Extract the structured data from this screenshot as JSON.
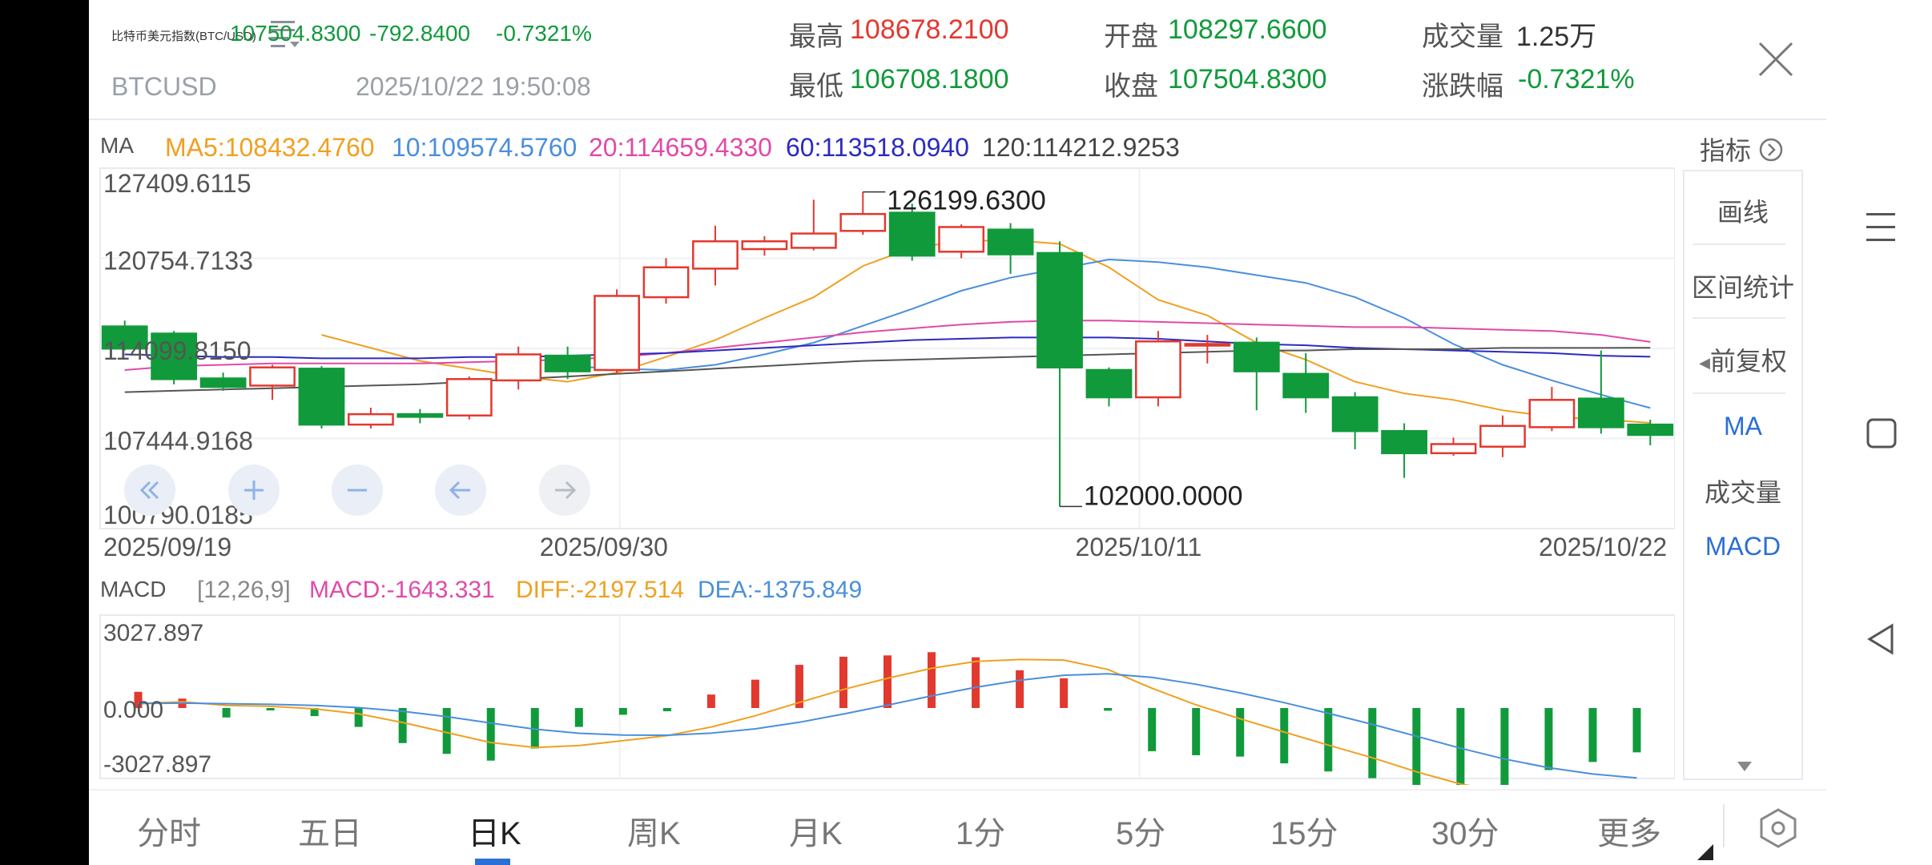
{
  "header": {
    "title": "比特币美元指数(BTC/USD)",
    "symbol": "BTCUSD",
    "price": "107504.8300",
    "change": "-792.8400",
    "change_pct": "-0.7321%",
    "datetime": "2025/10/22 19:50:08",
    "stats": {
      "high_label": "最高",
      "high": "108678.2100",
      "low_label": "最低",
      "low": "106708.1800",
      "open_label": "开盘",
      "open": "108297.6600",
      "close_label": "收盘",
      "close": "107504.8300",
      "volume_label": "成交量",
      "volume": "1.25万",
      "pct_label": "涨跌幅",
      "pct": "-0.7321%"
    }
  },
  "ma_bar": {
    "label": "MA",
    "ma5": "MA5:108432.4760",
    "ma10": "10:109574.5760",
    "ma20": "20:114659.4330",
    "ma60": "60:113518.0940",
    "ma120": "120:114212.9253",
    "indicator_label": "指标"
  },
  "sidebar": {
    "items": [
      "画线",
      "区间统计",
      "前复权",
      "MA",
      "成交量",
      "MACD"
    ]
  },
  "colors": {
    "up": "#e2392f",
    "down": "#119a3b",
    "ma5": "#f0a020",
    "ma10": "#4a8fdc",
    "ma20": "#e04aa8",
    "ma60": "#2b2bc0",
    "ma120": "#555555",
    "accent": "#2a6fd6"
  },
  "icons": {
    "menu": "list-menu-icon",
    "close": "close-icon",
    "indicator": "chevron-right-circle-icon",
    "settings": "hexagon-settings-icon"
  },
  "chart_data": [
    {
      "type": "candlestick",
      "title": "",
      "y_ticks": [
        "127409.6115",
        "120754.7133",
        "114099.8150",
        "107444.9168",
        "100790.0185"
      ],
      "ylim": [
        100790.0185,
        127409.6115
      ],
      "x_ticks": [
        "2025/09/19",
        "2025/09/30",
        "2025/10/11",
        "2025/10/22"
      ],
      "max_label": "126199.6300",
      "min_label": "102000.0000",
      "candles": [
        {
          "o": 115850,
          "h": 116300,
          "l": 114000,
          "c": 114150
        },
        {
          "o": 115300,
          "h": 115500,
          "l": 111400,
          "c": 111800
        },
        {
          "o": 111850,
          "h": 112300,
          "l": 110900,
          "c": 111200
        },
        {
          "o": 111300,
          "h": 112900,
          "l": 110200,
          "c": 112700
        },
        {
          "o": 112600,
          "h": 112800,
          "l": 108000,
          "c": 108300
        },
        {
          "o": 108300,
          "h": 109600,
          "l": 108000,
          "c": 109100
        },
        {
          "o": 109100,
          "h": 109500,
          "l": 108400,
          "c": 108900
        },
        {
          "o": 109000,
          "h": 112000,
          "l": 108700,
          "c": 111800
        },
        {
          "o": 111700,
          "h": 114300,
          "l": 111000,
          "c": 113700
        },
        {
          "o": 113600,
          "h": 114300,
          "l": 111800,
          "c": 112400
        },
        {
          "o": 112500,
          "h": 118700,
          "l": 112200,
          "c": 118200
        },
        {
          "o": 118100,
          "h": 121100,
          "l": 117600,
          "c": 120400
        },
        {
          "o": 120300,
          "h": 123600,
          "l": 119000,
          "c": 122400
        },
        {
          "o": 121800,
          "h": 122800,
          "l": 121300,
          "c": 122400
        },
        {
          "o": 121900,
          "h": 125600,
          "l": 121700,
          "c": 123000
        },
        {
          "o": 123200,
          "h": 126199.63,
          "l": 122900,
          "c": 124500
        },
        {
          "o": 124600,
          "h": 125300,
          "l": 120900,
          "c": 121300
        },
        {
          "o": 121600,
          "h": 123700,
          "l": 121100,
          "c": 123500
        },
        {
          "o": 123300,
          "h": 123800,
          "l": 119900,
          "c": 121400
        },
        {
          "o": 121500,
          "h": 122400,
          "l": 102000,
          "c": 112700
        },
        {
          "o": 112500,
          "h": 112700,
          "l": 109700,
          "c": 110400
        },
        {
          "o": 110400,
          "h": 115500,
          "l": 109700,
          "c": 114700
        },
        {
          "o": 114400,
          "h": 115200,
          "l": 113000,
          "c": 114500
        },
        {
          "o": 114600,
          "h": 115000,
          "l": 109400,
          "c": 112400
        },
        {
          "o": 112200,
          "h": 113800,
          "l": 109200,
          "c": 110400
        },
        {
          "o": 110400,
          "h": 110800,
          "l": 106400,
          "c": 107800
        },
        {
          "o": 107800,
          "h": 108400,
          "l": 104200,
          "c": 106100
        },
        {
          "o": 106100,
          "h": 107300,
          "l": 105900,
          "c": 106800
        },
        {
          "o": 106600,
          "h": 109000,
          "l": 105800,
          "c": 108200
        },
        {
          "o": 108100,
          "h": 111200,
          "l": 107800,
          "c": 110200
        },
        {
          "o": 110300,
          "h": 114000,
          "l": 107600,
          "c": 108100
        },
        {
          "o": 108297.66,
          "h": 108678.21,
          "l": 106708.18,
          "c": 107504.83
        }
      ],
      "series": [
        {
          "name": "MA5",
          "values": [
            null,
            null,
            null,
            null,
            115200,
            114200,
            113200,
            112600,
            112000,
            111600,
            112300,
            113500,
            114800,
            116500,
            118100,
            120500,
            121900,
            122400,
            122500,
            122200,
            120400,
            117900,
            116700,
            114600,
            113300,
            111600,
            110700,
            110200,
            109400,
            108900,
            108700,
            108432
          ]
        },
        {
          "name": "MA10",
          "values": [
            null,
            null,
            null,
            null,
            null,
            null,
            null,
            null,
            null,
            112800,
            112600,
            112500,
            112900,
            113700,
            114600,
            115900,
            117200,
            118600,
            119600,
            120300,
            121000,
            120800,
            120400,
            119800,
            119200,
            118100,
            116500,
            114500,
            112900,
            111700,
            110600,
            109575
          ]
        },
        {
          "name": "MA20",
          "values": [
            112500,
            112800,
            112900,
            113000,
            113000,
            113000,
            113000,
            113100,
            113200,
            113300,
            113500,
            113800,
            114200,
            114600,
            115000,
            115400,
            115700,
            116000,
            116200,
            116300,
            116300,
            116200,
            116100,
            116000,
            115900,
            115800,
            115800,
            115700,
            115600,
            115500,
            115200,
            114659
          ]
        },
        {
          "name": "MA60",
          "values": [
            113700,
            113600,
            113500,
            113500,
            113400,
            113400,
            113400,
            113500,
            113500,
            113600,
            113700,
            113800,
            114000,
            114200,
            114400,
            114600,
            114800,
            114900,
            115000,
            115000,
            115000,
            114900,
            114700,
            114500,
            114400,
            114200,
            114100,
            114000,
            113900,
            113800,
            113600,
            113518
          ]
        },
        {
          "name": "MA120",
          "values": [
            110800,
            110900,
            111000,
            111100,
            111200,
            111300,
            111400,
            111600,
            111800,
            112000,
            112200,
            112400,
            112600,
            112800,
            113000,
            113200,
            113300,
            113400,
            113500,
            113600,
            113700,
            113800,
            113900,
            114000,
            114000,
            114100,
            114100,
            114100,
            114200,
            114200,
            114200,
            114213
          ]
        }
      ]
    },
    {
      "type": "bar",
      "title": "MACD",
      "params": "[12,26,9]",
      "macd_label": "MACD:-1643.331",
      "diff_label": "DIFF:-2197.514",
      "dea_label": "DEA:-1375.849",
      "y_ticks": [
        "3027.897",
        "0.000",
        "-3027.897"
      ],
      "ylim": [
        -3027.897,
        3027.897
      ],
      "macd": [
        600,
        350,
        -350,
        -50,
        -300,
        -700,
        -1300,
        -1700,
        -1950,
        -1500,
        -700,
        -250,
        -120,
        500,
        1050,
        1600,
        1900,
        1950,
        2070,
        1880,
        1400,
        1100,
        -100,
        -1600,
        -1750,
        -1800,
        -2050,
        -2350,
        -2600,
        -3100,
        -3200,
        -2850,
        -2300,
        -2000,
        -1643
      ]
    }
  ],
  "bottom_tabs": [
    "分时",
    "五日",
    "日K",
    "周K",
    "月K",
    "1分",
    "5分",
    "15分",
    "30分",
    "更多"
  ],
  "active_tab": "日K"
}
